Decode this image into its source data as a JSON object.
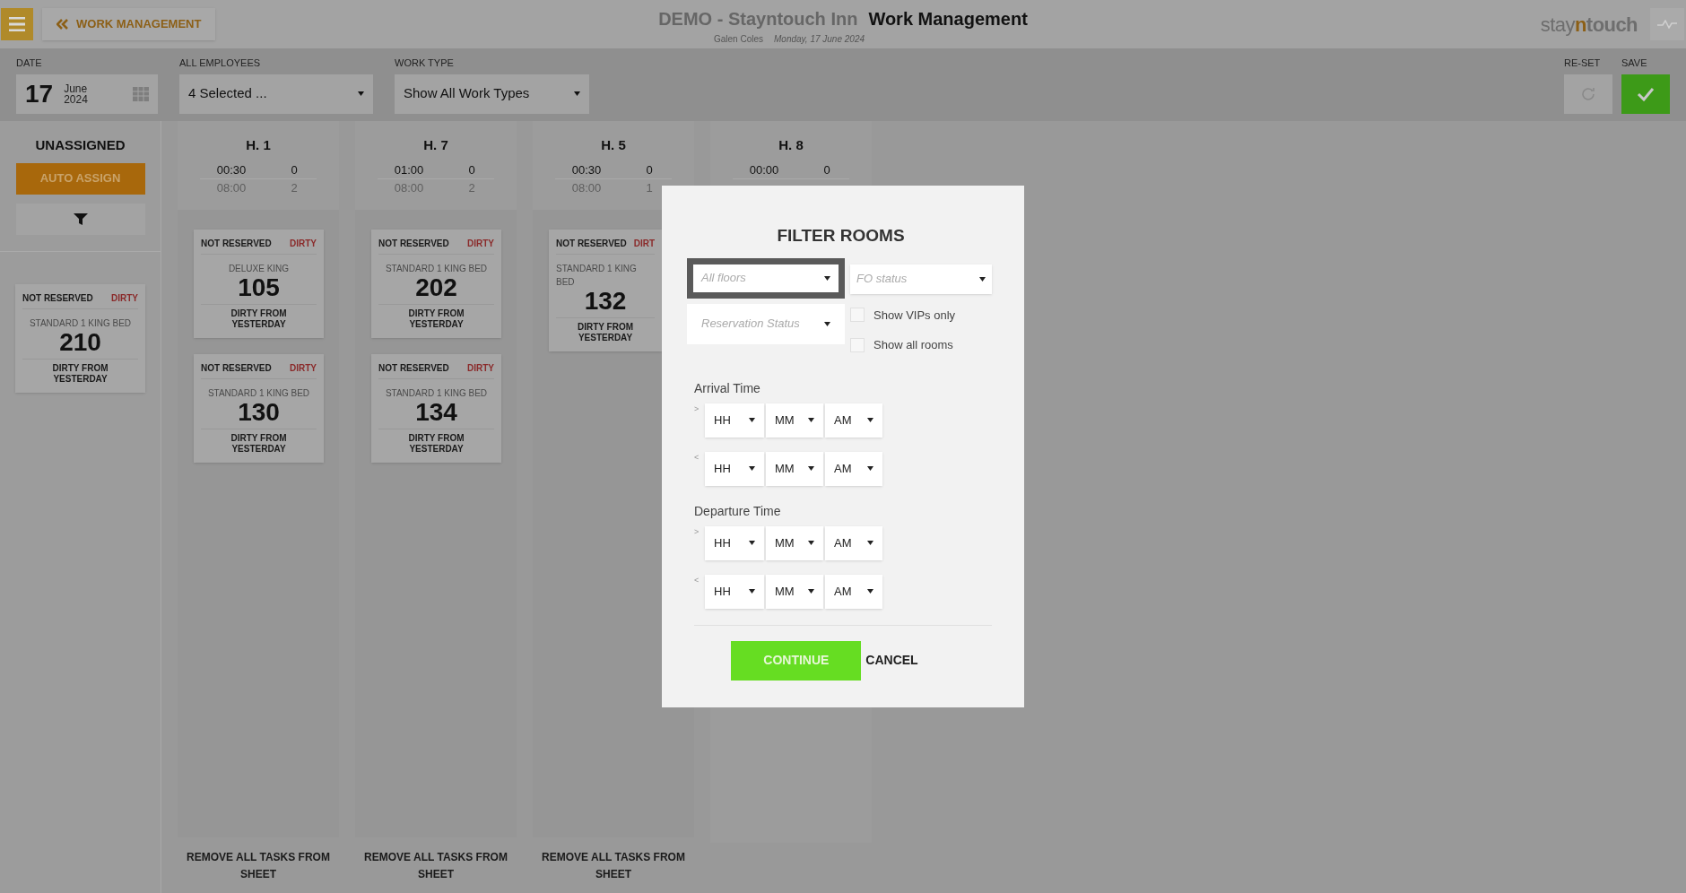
{
  "header": {
    "back_label": "WORK MANAGEMENT",
    "hotel": "DEMO - Stayntouch Inn",
    "title": "Work Management",
    "user": "Galen Coles",
    "date": "Monday, 17 June 2024",
    "logo": [
      "stay",
      "n",
      "touch"
    ]
  },
  "toolbar": {
    "date": {
      "label": "DATE",
      "day": "17",
      "month": "June",
      "year": "2024"
    },
    "employees": {
      "label": "ALL EMPLOYEES",
      "value": "4 Selected ..."
    },
    "work_type": {
      "label": "WORK TYPE",
      "value": "Show All Work Types"
    },
    "reset_label": "RE-SET",
    "save_label": "SAVE"
  },
  "unassigned": {
    "title": "UNASSIGNED",
    "auto_assign": "AUTO ASSIGN",
    "rooms": [
      {
        "reservation": "NOT RESERVED",
        "status": "DIRTY",
        "type": "STANDARD 1 KING BED",
        "number": "210",
        "note": "DIRTY FROM YESTERDAY"
      }
    ]
  },
  "columns": [
    {
      "title": "H. 1",
      "stats": [
        [
          "00:30",
          "0"
        ],
        [
          "08:00",
          "2"
        ]
      ],
      "rooms": [
        {
          "reservation": "NOT RESERVED",
          "status": "DIRTY",
          "type": "DELUXE KING",
          "number": "105",
          "note": "DIRTY FROM YESTERDAY"
        },
        {
          "reservation": "NOT RESERVED",
          "status": "DIRTY",
          "type": "STANDARD 1 KING BED",
          "number": "130",
          "note": "DIRTY FROM YESTERDAY"
        }
      ],
      "footer": "REMOVE ALL TASKS FROM SHEET"
    },
    {
      "title": "H. 7",
      "stats": [
        [
          "01:00",
          "0"
        ],
        [
          "08:00",
          "2"
        ]
      ],
      "rooms": [
        {
          "reservation": "NOT RESERVED",
          "status": "DIRTY",
          "type": "STANDARD 1 KING BED",
          "number": "202",
          "note": "DIRTY FROM YESTERDAY"
        },
        {
          "reservation": "NOT RESERVED",
          "status": "DIRTY",
          "type": "STANDARD 1 KING BED",
          "number": "134",
          "note": "DIRTY FROM YESTERDAY"
        }
      ],
      "footer": "REMOVE ALL TASKS FROM SHEET"
    },
    {
      "title": "H. 5",
      "stats": [
        [
          "00:30",
          "0"
        ],
        [
          "08:00",
          "1"
        ]
      ],
      "rooms": [
        {
          "reservation": "NOT RESERVED",
          "status": "DIRT",
          "type": "STANDARD 1 KING BED",
          "number": "132",
          "note": "DIRTY FROM YESTERDAY"
        }
      ],
      "footer": "REMOVE ALL TASKS FROM SHEET"
    },
    {
      "title": "H. 8",
      "stats": [
        [
          "00:00",
          "0"
        ]
      ]
    }
  ],
  "modal": {
    "title": "FILTER ROOMS",
    "selects": [
      {
        "placeholder": "All floors",
        "focused": true
      },
      {
        "placeholder": "FO status",
        "focused": false
      },
      {
        "placeholder": "Reservation Status",
        "focused": false
      }
    ],
    "checkboxes": [
      {
        "label": "Show VIPs only",
        "checked": false
      },
      {
        "label": "Show all rooms",
        "checked": false
      }
    ],
    "time_groups": [
      {
        "label": "Arrival Time",
        "rows": [
          {
            "op": ">",
            "fields": [
              "HH",
              "MM",
              "AM"
            ]
          },
          {
            "op": "<",
            "fields": [
              "HH",
              "MM",
              "AM"
            ]
          }
        ]
      },
      {
        "label": "Departure Time",
        "rows": [
          {
            "op": ">",
            "fields": [
              "HH",
              "MM",
              "AM"
            ]
          },
          {
            "op": "<",
            "fields": [
              "HH",
              "MM",
              "AM"
            ]
          }
        ]
      }
    ],
    "continue": "CONTINUE",
    "cancel": "CANCEL"
  }
}
